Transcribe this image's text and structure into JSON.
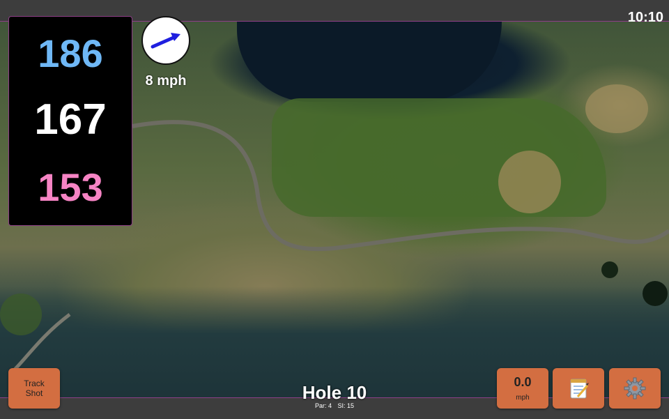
{
  "clock": "10:10",
  "yardages": {
    "back": "186",
    "middle": "167",
    "front": "153"
  },
  "wind": {
    "speed_label": "8 mph",
    "direction_icon": "wind-arrow-icon"
  },
  "hole": {
    "title": "Hole 10",
    "par": "Par: 4",
    "stroke_index": "SI: 15"
  },
  "buttons": {
    "track_shot_line1": "Track",
    "track_shot_line2": "Shot",
    "speed_value": "0.0",
    "speed_unit": "mph",
    "notes_icon": "notepad-icon",
    "settings_icon": "gear-icon"
  },
  "colors": {
    "back_yardage": "#6fb8f6",
    "middle_yardage": "#ffffff",
    "front_yardage": "#f684c4",
    "button_orange": "#d36e41",
    "accent_border": "#8e3f88"
  }
}
